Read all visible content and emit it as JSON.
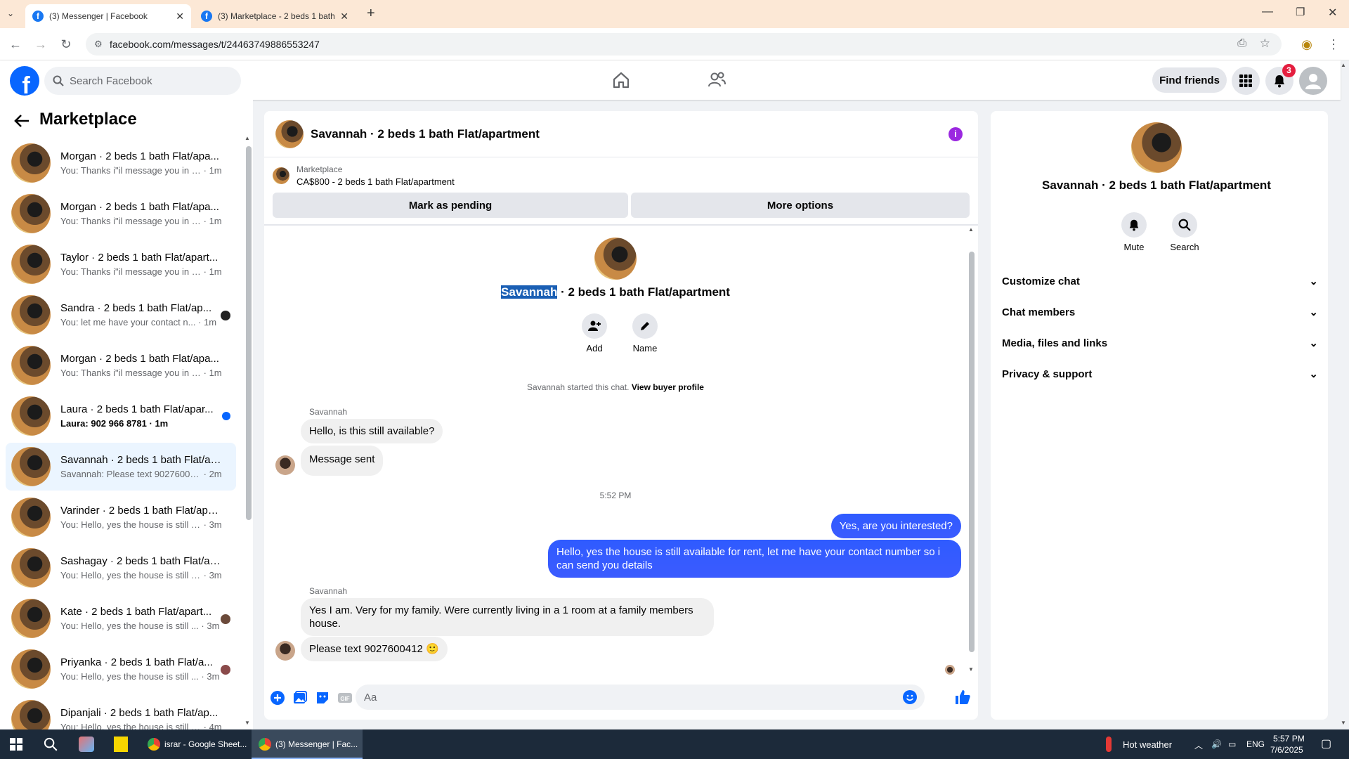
{
  "browser": {
    "tabs": [
      {
        "title": "(3) Messenger | Facebook"
      },
      {
        "title": "(3) Marketplace - 2 beds 1 bath"
      }
    ],
    "url": "facebook.com/messages/t/24463749886553247"
  },
  "fb": {
    "search_placeholder": "Search Facebook",
    "find_friends": "Find friends",
    "notif_count": "3"
  },
  "left": {
    "title": "Marketplace",
    "conversations": [
      {
        "name": "Morgan · 2 beds 1 bath Flat/apa...",
        "preview": "You: Thanks i\"il message you in a ...",
        "time": "1m"
      },
      {
        "name": "Morgan · 2 beds 1 bath Flat/apa...",
        "preview": "You: Thanks i\"il message you in a ...",
        "time": "1m"
      },
      {
        "name": "Taylor · 2 beds 1 bath Flat/apart...",
        "preview": "You: Thanks i\"il message you in a ...",
        "time": "1m"
      },
      {
        "name": "Sandra · 2 beds 1 bath Flat/ap...",
        "preview": "You: let me have your contact n...",
        "time": "1m"
      },
      {
        "name": "Morgan · 2 beds 1 bath Flat/apa...",
        "preview": "You: Thanks i\"il message you in a ...",
        "time": "1m"
      },
      {
        "name": "Laura · 2 beds 1 bath Flat/apar...",
        "preview": "Laura: 902 966 8781",
        "time": "1m"
      },
      {
        "name": "Savannah · 2 beds 1 bath Flat/ap...",
        "preview": "Savannah: Please text 9027600412...",
        "time": "2m"
      },
      {
        "name": "Varinder · 2 beds 1 bath Flat/apa...",
        "preview": "You: Hello, yes the house is still av...",
        "time": "3m"
      },
      {
        "name": "Sashagay · 2 beds 1 bath Flat/ap...",
        "preview": "You: Hello, yes the house is still av...",
        "time": "3m"
      },
      {
        "name": "Kate · 2 beds 1 bath Flat/apart...",
        "preview": "You: Hello, yes the house is still ...",
        "time": "3m"
      },
      {
        "name": "Priyanka · 2 beds 1 bath Flat/a...",
        "preview": "You: Hello, yes the house is still ...",
        "time": "3m"
      },
      {
        "name": "Dipanjali · 2 beds 1 bath Flat/ap...",
        "preview": "You: Hello, yes the house is still av...",
        "time": "4m"
      }
    ]
  },
  "chat": {
    "title": "Savannah · 2 beds 1 bath Flat/apartment",
    "listing_source": "Marketplace",
    "listing_desc": "CA$800 - 2 beds 1 bath Flat/apartment",
    "mark_pending": "Mark as pending",
    "more_options": "More options",
    "profile_name_highlight": "Savannah",
    "profile_name_rest": " · 2 beds 1 bath Flat/apartment",
    "add_label": "Add",
    "name_label": "Name",
    "started_text": "Savannah started this chat.",
    "view_buyer": "View buyer profile",
    "sender1": "Savannah",
    "msg1": "Hello, is this still available?",
    "msg2": "Message sent",
    "time_sep": "5:52 PM",
    "msg3": "Yes, are you interested?",
    "msg4": "Hello, yes the house is still available for rent, let me have your contact number so i can send you details",
    "sender2": "Savannah",
    "msg5": "Yes I am. Very for my family. Were currently living in a 1 room at a family members house.",
    "msg6": "Please text 9027600412 🙂",
    "composer_placeholder": "Aa"
  },
  "right": {
    "name": "Savannah · 2 beds 1 bath Flat/apartment",
    "mute": "Mute",
    "search": "Search",
    "sections": [
      "Customize chat",
      "Chat members",
      "Media, files and links",
      "Privacy & support"
    ]
  },
  "taskbar": {
    "app1": "israr - Google Sheet...",
    "app2": "(3) Messenger | Fac...",
    "weather": "Hot weather",
    "lang": "ENG",
    "time": "5:57 PM",
    "date": "7/6/2025"
  },
  "colors": {
    "accent": "#0866ff",
    "outgoing": "#3b5bff",
    "notif": "#e41e3f"
  }
}
